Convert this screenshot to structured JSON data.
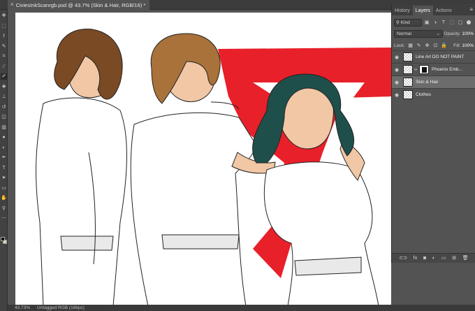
{
  "document": {
    "tab_title": "CiviesInkScanrgb.psd @ 43.7% (Skin & Hair, RGB/16) *",
    "close_glyph": "×"
  },
  "toolbar": {
    "tools": [
      {
        "name": "move-tool-icon",
        "glyph": "✥"
      },
      {
        "name": "marquee-tool-icon",
        "glyph": "⬚"
      },
      {
        "name": "lasso-tool-icon",
        "glyph": "ℓ"
      },
      {
        "name": "quick-select-tool-icon",
        "glyph": "✎"
      },
      {
        "name": "crop-tool-icon",
        "glyph": "⌗"
      },
      {
        "name": "eyedropper-tool-icon",
        "glyph": "⁄"
      },
      {
        "name": "brush-tool-icon",
        "glyph": "✐"
      },
      {
        "name": "healing-tool-icon",
        "glyph": "✚"
      },
      {
        "name": "clone-stamp-tool-icon",
        "glyph": "⊥"
      },
      {
        "name": "history-brush-tool-icon",
        "glyph": "↺"
      },
      {
        "name": "eraser-tool-icon",
        "glyph": "◫"
      },
      {
        "name": "gradient-tool-icon",
        "glyph": "▥"
      },
      {
        "name": "blur-tool-icon",
        "glyph": "●"
      },
      {
        "name": "dodge-tool-icon",
        "glyph": "◐"
      },
      {
        "name": "pen-tool-icon",
        "glyph": "✒"
      },
      {
        "name": "type-tool-icon",
        "glyph": "T"
      },
      {
        "name": "path-select-tool-icon",
        "glyph": "➤"
      },
      {
        "name": "rectangle-tool-icon",
        "glyph": "▭"
      },
      {
        "name": "hand-tool-icon",
        "glyph": "✋"
      },
      {
        "name": "zoom-tool-icon",
        "glyph": "⚲"
      },
      {
        "name": "more-tools-icon",
        "glyph": "⋯"
      }
    ],
    "foreground_color": "#111111",
    "background_color": "#e2d3b6"
  },
  "status": {
    "zoom": "43.73%",
    "profile": "Untagged RGB (16bpc)"
  },
  "panel": {
    "tabs": [
      {
        "label": "History",
        "active": false
      },
      {
        "label": "Layers",
        "active": true
      },
      {
        "label": "Actions",
        "active": false
      }
    ],
    "menu_glyph": "≡",
    "filter": {
      "kind_label": "Kind",
      "icons": [
        {
          "name": "pixel-filter-icon",
          "glyph": "▣"
        },
        {
          "name": "adjustment-filter-icon",
          "glyph": "◑"
        },
        {
          "name": "type-filter-icon",
          "glyph": "T"
        },
        {
          "name": "shape-filter-icon",
          "glyph": "⬚"
        },
        {
          "name": "smart-object-filter-icon",
          "glyph": "▢"
        }
      ]
    },
    "blend_mode": "Normal",
    "opacity_label": "Opacity:",
    "opacity_value": "100%",
    "lock_label": "Lock:",
    "lock_icons": [
      {
        "name": "lock-transparent-icon",
        "glyph": "▦"
      },
      {
        "name": "lock-paint-icon",
        "glyph": "✎"
      },
      {
        "name": "lock-position-icon",
        "glyph": "✥"
      },
      {
        "name": "lock-artboard-icon",
        "glyph": "⊡"
      },
      {
        "name": "lock-all-icon",
        "glyph": "🔒"
      }
    ],
    "fill_label": "Fill:",
    "fill_value": "100%",
    "layers": [
      {
        "name": "Line Art DO NOT PAINT",
        "visible": true,
        "selected": false,
        "thumb": "checker",
        "locked": true
      },
      {
        "name": "Phoenix Emb...",
        "visible": true,
        "selected": false,
        "thumb": "mask",
        "locked": false
      },
      {
        "name": "Skin & Hair",
        "visible": true,
        "selected": true,
        "thumb": "checker",
        "locked": false
      },
      {
        "name": "Clothes",
        "visible": true,
        "selected": false,
        "thumb": "checker",
        "locked": false
      }
    ],
    "footer_icons": [
      {
        "name": "link-layers-icon",
        "glyph": "⊂⊃"
      },
      {
        "name": "layer-style-icon",
        "glyph": "fx"
      },
      {
        "name": "add-mask-icon",
        "glyph": "◙"
      },
      {
        "name": "adjustment-layer-icon",
        "glyph": "◐"
      },
      {
        "name": "new-group-icon",
        "glyph": "▭"
      },
      {
        "name": "new-layer-icon",
        "glyph": "⊞"
      },
      {
        "name": "delete-layer-icon",
        "glyph": "🗑"
      }
    ]
  },
  "colors": {
    "phoenix_red": "#e8202a",
    "hair_brown": "#7a4a24",
    "hair_blonde": "#a8723a",
    "hair_teal": "#1f4f4a",
    "skin": "#f1c7a5"
  }
}
